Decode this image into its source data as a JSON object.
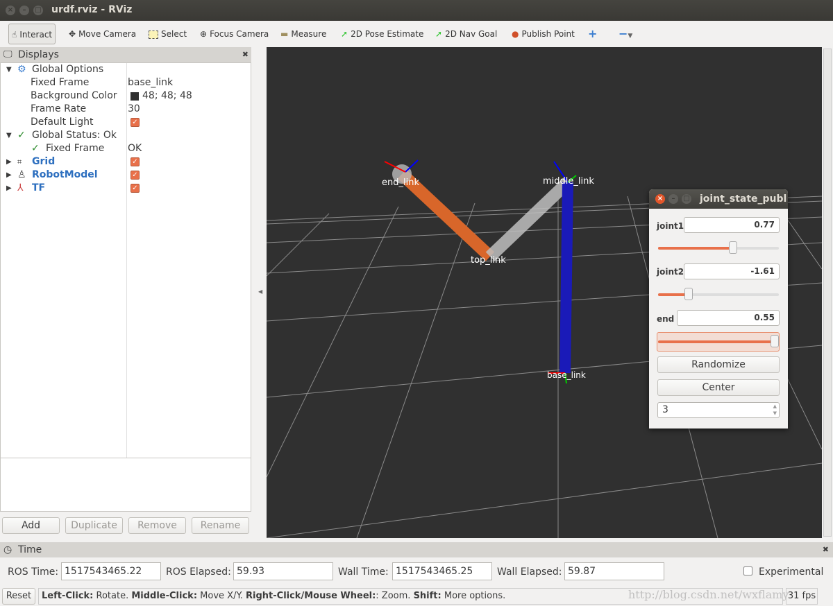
{
  "window": {
    "title": "urdf.rviz - RViz"
  },
  "toolbar": {
    "items": [
      {
        "label": "Interact",
        "icon": "hand-icon"
      },
      {
        "label": "Move Camera",
        "icon": "move-camera-icon"
      },
      {
        "label": "Select",
        "icon": "select-icon"
      },
      {
        "label": "Focus Camera",
        "icon": "focus-camera-icon"
      },
      {
        "label": "Measure",
        "icon": "ruler-icon"
      },
      {
        "label": "2D Pose Estimate",
        "icon": "green-arrow-icon"
      },
      {
        "label": "2D Nav Goal",
        "icon": "green-arrow-icon"
      },
      {
        "label": "Publish Point",
        "icon": "map-pin-icon"
      }
    ]
  },
  "displays": {
    "title": "Displays",
    "rows": [
      {
        "key": "Global Options",
        "value": ""
      },
      {
        "key": "Fixed Frame",
        "value": "base_link"
      },
      {
        "key": "Background Color",
        "value": "48; 48; 48"
      },
      {
        "key": "Frame Rate",
        "value": "30"
      },
      {
        "key": "Default Light",
        "value": ""
      },
      {
        "key": "Global Status: Ok",
        "value": ""
      },
      {
        "key": "Fixed Frame",
        "value": "OK"
      },
      {
        "key": "Grid",
        "value": ""
      },
      {
        "key": "RobotModel",
        "value": ""
      },
      {
        "key": "TF",
        "value": ""
      }
    ],
    "buttons": {
      "add": "Add",
      "duplicate": "Duplicate",
      "remove": "Remove",
      "rename": "Rename"
    }
  },
  "viewport": {
    "background": "#303030",
    "labels": {
      "end": "end_link",
      "middle": "middle_link",
      "top": "top_link",
      "base": "base_link"
    }
  },
  "joint_state_publisher": {
    "title": "joint_state_publ",
    "joints": [
      {
        "name": "joint1",
        "value": "0.77",
        "fraction": 0.62
      },
      {
        "name": "joint2",
        "value": "-1.61",
        "fraction": 0.25
      },
      {
        "name": "end",
        "value": "0.55",
        "fraction": 1.0
      }
    ],
    "randomize": "Randomize",
    "center": "Center",
    "spin_value": "3"
  },
  "time": {
    "title": "Time",
    "ros_time_label": "ROS Time:",
    "ros_time": "1517543465.22",
    "ros_elapsed_label": "ROS Elapsed:",
    "ros_elapsed": "59.93",
    "wall_time_label": "Wall Time:",
    "wall_time": "1517543465.25",
    "wall_elapsed_label": "Wall Elapsed:",
    "wall_elapsed": "59.87",
    "experimental": "Experimental"
  },
  "status": {
    "reset": "Reset",
    "h1": "Left-Click:",
    "t1": " Rotate. ",
    "h2": "Middle-Click:",
    "t2": " Move X/Y. ",
    "h3": "Right-Click/Mouse Wheel:",
    "t3": ": Zoom. ",
    "h4": "Shift:",
    "t4": " More options.",
    "fps": "31 fps",
    "watermark": "http://blog.csdn.net/wxflamy"
  }
}
